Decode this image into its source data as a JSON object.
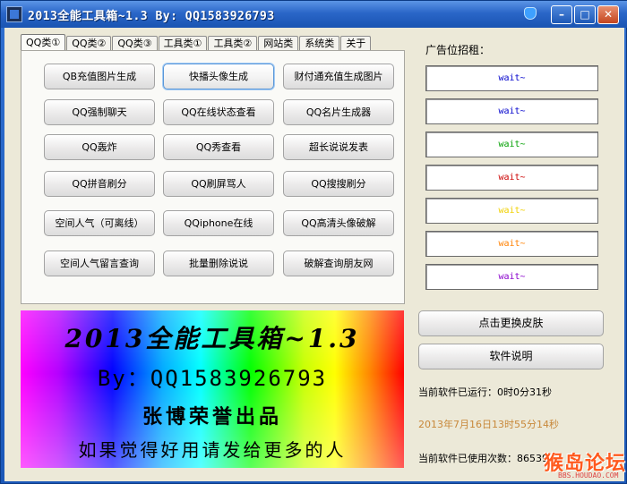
{
  "window": {
    "title": "2013全能工具箱~1.3  By: QQ1583926793",
    "min_label": "–",
    "max_label": "□",
    "close_label": "✕"
  },
  "tabs": [
    {
      "label": "QQ类①",
      "active": true
    },
    {
      "label": "QQ类②",
      "active": false
    },
    {
      "label": "QQ类③",
      "active": false
    },
    {
      "label": "工具类①",
      "active": false
    },
    {
      "label": "工具类②",
      "active": false
    },
    {
      "label": "网站类",
      "active": false
    },
    {
      "label": "系统类",
      "active": false
    },
    {
      "label": "关于",
      "active": false
    }
  ],
  "buttons": [
    "QB充值图片生成",
    "快播头像生成",
    "财付通充值生成图片",
    "QQ强制聊天",
    "QQ在线状态查看",
    "QQ名片生成器",
    "QQ轰炸",
    "QQ秀查看",
    "超长说说发表",
    "QQ拼音刷分",
    "QQ刷屏骂人",
    "QQ搜搜刷分",
    "空间人气（可离线）",
    "QQiphone在线",
    "QQ高清头像破解",
    "空间人气留言查询",
    "批量删除说说",
    "破解查询朋友网"
  ],
  "banner": {
    "line1": "2013全能工具箱~1.3",
    "line2": "By：QQ1583926793",
    "line3": "张博荣誉出品",
    "line4": "如果觉得好用请发给更多的人"
  },
  "ads": {
    "label": "广告位招租：",
    "items": [
      {
        "text": "wait~",
        "color": "#0000cc"
      },
      {
        "text": "wait~",
        "color": "#0000cc"
      },
      {
        "text": "wait~",
        "color": "#00a000"
      },
      {
        "text": "wait~",
        "color": "#cc0000"
      },
      {
        "text": "wait~",
        "color": "#f0d000"
      },
      {
        "text": "wait~",
        "color": "#ff8000"
      },
      {
        "text": "wait~",
        "color": "#8800cc"
      }
    ]
  },
  "side_buttons": {
    "skin": "点击更换皮肤",
    "help": "软件说明"
  },
  "status": {
    "runtime": "当前软件已运行：0时0分31秒",
    "datetime": "2013年7月16日13时55分14秒",
    "count": "当前软件已使用次数：86539"
  },
  "watermark": {
    "text": "猴岛论坛",
    "url": "BBS.HOUDAO.COM"
  }
}
